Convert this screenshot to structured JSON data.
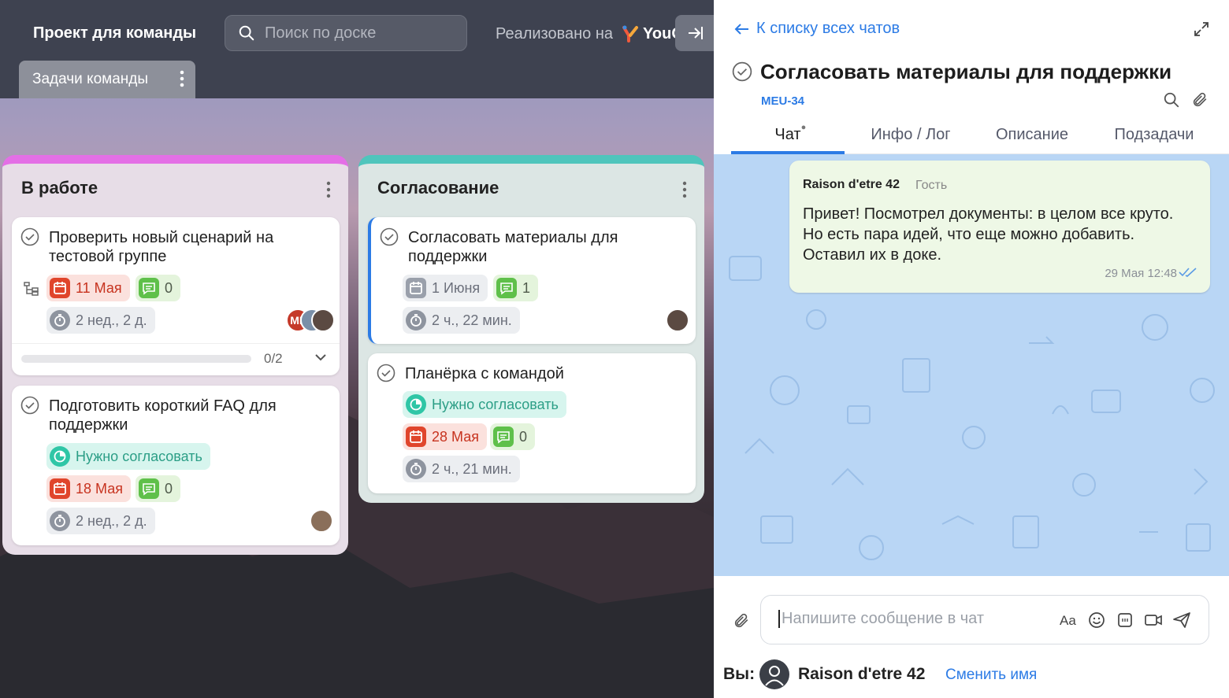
{
  "board": {
    "project_title": "Проект для команды",
    "search_placeholder": "Поиск по доске",
    "powered_by": "Реализовано на",
    "brand": "YouGile",
    "tab": "Задачи команды",
    "columns": [
      {
        "title": "В работе",
        "color": "#e46fe6",
        "cards": [
          {
            "title": "Проверить новый сценарий на тестовой группе",
            "date": "11 Мая",
            "comments": "0",
            "time": "2 нед., 2 д.",
            "avatar_initials": "МГ",
            "subtasks_progress": "0/2"
          },
          {
            "title": "Подготовить короткий FAQ для поддержки",
            "status": "Нужно согласовать",
            "date": "18 Мая",
            "comments": "0",
            "time": "2 нед., 2 д."
          }
        ]
      },
      {
        "title": "Согласование",
        "color": "#4fc5bc",
        "cards": [
          {
            "title": "Согласовать материалы для поддержки",
            "date": "1 Июня",
            "comments": "1",
            "time": "2 ч., 22 мин."
          },
          {
            "title": "Планёрка с командой",
            "status": "Нужно согласовать",
            "date": "28 Мая",
            "comments": "0",
            "time": "2 ч., 21 мин."
          }
        ]
      }
    ]
  },
  "chat": {
    "back_link": "К списку всех чатов",
    "task_title": "Согласовать материалы для поддержки",
    "task_id": "MEU-34",
    "tabs": [
      {
        "label": "Чат",
        "active": true
      },
      {
        "label": "Инфо / Лог",
        "active": false
      },
      {
        "label": "Описание",
        "active": false
      },
      {
        "label": "Подзадачи",
        "active": false
      }
    ],
    "message": {
      "author": "Raison d'etre 42",
      "role": "Гость",
      "lines": [
        "Привет! Посмотрел документы: в целом все круто.",
        "Но есть пара идей, что еще можно добавить.",
        "Оставил их в доке."
      ],
      "time": "29 Мая 12:48"
    },
    "composer_placeholder": "Напишите сообщение в чат",
    "footer": {
      "you_label": "Вы:",
      "name": "Raison d'etre 42",
      "rename": "Сменить имя"
    }
  },
  "colors": {
    "accent": "#2c7be5",
    "date_red": "#e0452c",
    "comment_green": "#5fc04a",
    "status_teal": "#2fc6a6"
  }
}
